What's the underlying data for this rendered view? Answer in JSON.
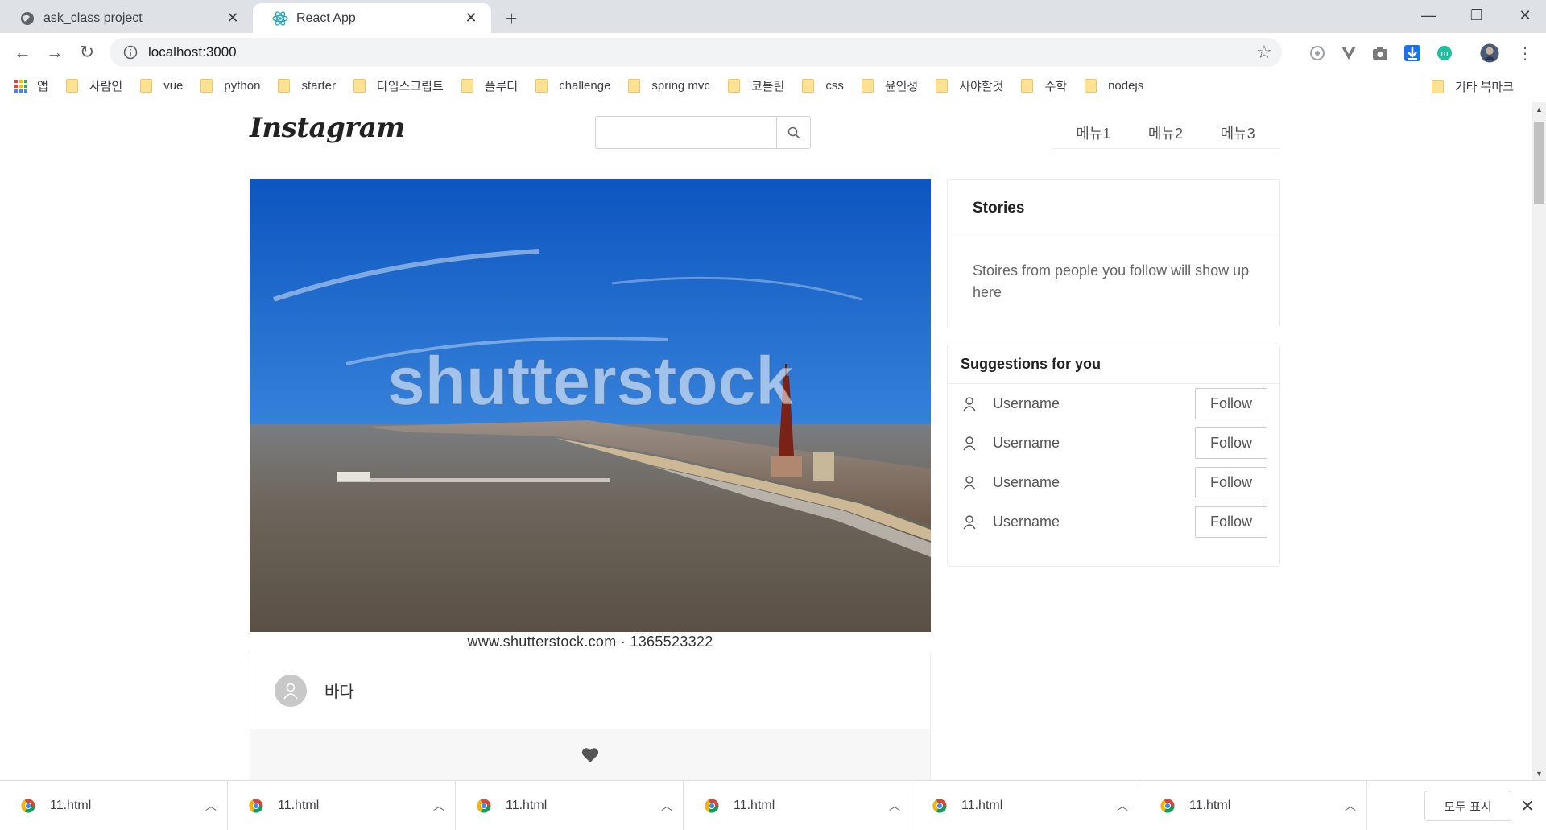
{
  "browser": {
    "tabs": [
      {
        "title": "ask_class project",
        "icon": "globe-icon"
      },
      {
        "title": "React App",
        "icon": "react-icon"
      }
    ],
    "new_tab_label": "+",
    "url": "localhost:3000",
    "bookmarks": [
      {
        "label": "앱",
        "icon": "apps-icon"
      },
      {
        "label": "사람인"
      },
      {
        "label": "vue"
      },
      {
        "label": "python"
      },
      {
        "label": "starter"
      },
      {
        "label": "타입스크립트"
      },
      {
        "label": "플루터"
      },
      {
        "label": "challenge"
      },
      {
        "label": "spring mvc"
      },
      {
        "label": "코틀린"
      },
      {
        "label": "css"
      },
      {
        "label": "윤인성"
      },
      {
        "label": "사야할것"
      },
      {
        "label": "수학"
      },
      {
        "label": "nodejs"
      }
    ],
    "other_bookmarks": "기타 북마크"
  },
  "page": {
    "logo": "Instagram",
    "search": {
      "value": "",
      "placeholder": ""
    },
    "menu": [
      "메뉴1",
      "메뉴2",
      "메뉴3"
    ],
    "post": {
      "image_watermark": "shutterstock",
      "image_caption": "www.shutterstock.com · 1365523322",
      "title": "바다"
    },
    "stories": {
      "title": "Stories",
      "body": "Stoires from people you follow will show up here"
    },
    "suggestions": {
      "title": "Suggestions for you",
      "users": [
        {
          "name": "Username",
          "button": "Follow"
        },
        {
          "name": "Username",
          "button": "Follow"
        },
        {
          "name": "Username",
          "button": "Follow"
        },
        {
          "name": "Username",
          "button": "Follow"
        }
      ]
    }
  },
  "downloads": {
    "items": [
      "11.html",
      "11.html",
      "11.html",
      "11.html",
      "11.html",
      "11.html"
    ],
    "show_all": "모두 표시"
  },
  "colors": {
    "tabstrip": "#dee1e6",
    "folder": "#fde293",
    "sky": "#1565c8",
    "sea": "#6a6258"
  }
}
